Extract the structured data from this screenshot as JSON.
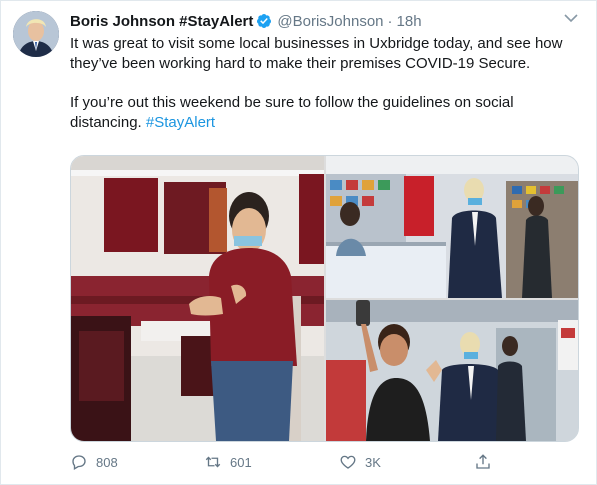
{
  "tweet": {
    "display_name": "Boris Johnson #StayAlert",
    "handle": "@BorisJohnson",
    "separator": "·",
    "time": "18h",
    "paragraph1": "It was great to visit some local businesses in Uxbridge today, and see how they’ve been working hard to make their premises COVID-19 Secure.",
    "paragraph2_text": "If you’re out this weekend be sure to follow the guidelines on social distancing. ",
    "hashtag": "#StayAlert"
  },
  "photos": [
    {
      "icon": "photo-restaurant"
    },
    {
      "icon": "photo-shop"
    },
    {
      "icon": "photo-selfie"
    }
  ],
  "actions": {
    "reply_count": "808",
    "retweet_count": "601",
    "like_count": "3K"
  },
  "colors": {
    "link": "#1b95e0",
    "verified": "#1da1f2",
    "muted": "#657786",
    "border": "#e1e8ed"
  }
}
